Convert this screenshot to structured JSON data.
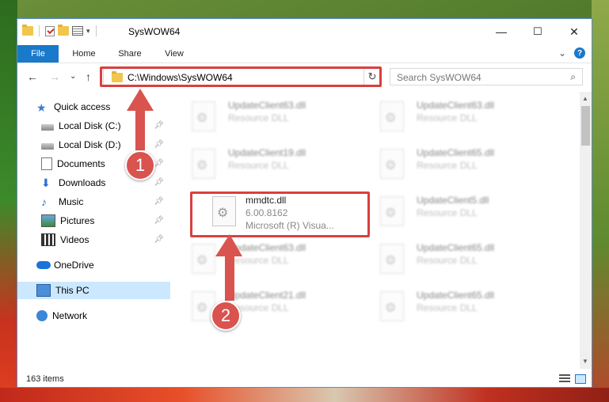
{
  "window": {
    "title": "SysWOW64",
    "controls": {
      "minimize": "—",
      "maximize": "☐",
      "close": "✕"
    }
  },
  "ribbon": {
    "tabs": [
      "File",
      "Home",
      "Share",
      "View"
    ],
    "collapse_glyph": "⌄",
    "help_glyph": "?"
  },
  "nav": {
    "back": "←",
    "forward": "→",
    "recent": "⌄",
    "up": "↑"
  },
  "address": {
    "path": "C:\\Windows\\SysWOW64",
    "dropdown_glyph": "⌄",
    "refresh_glyph": "↻"
  },
  "search": {
    "placeholder": "Search SysWOW64",
    "icon_glyph": "⌕"
  },
  "sidebar": {
    "items": [
      {
        "label": "Quick access",
        "icon": "star-icon"
      },
      {
        "label": "Local Disk (C:)",
        "icon": "drive-icon"
      },
      {
        "label": "Local Disk (D:)",
        "icon": "drive-icon"
      },
      {
        "label": "Documents",
        "icon": "documents-icon"
      },
      {
        "label": "Downloads",
        "icon": "downloads-icon"
      },
      {
        "label": "Music",
        "icon": "music-icon"
      },
      {
        "label": "Pictures",
        "icon": "pictures-icon"
      },
      {
        "label": "Videos",
        "icon": "videos-icon"
      },
      {
        "label": "OneDrive",
        "icon": "onedrive-icon"
      },
      {
        "label": "This PC",
        "icon": "this-pc-icon"
      },
      {
        "label": "Network",
        "icon": "network-icon"
      }
    ],
    "pin_glyph": "✎"
  },
  "files": [
    {
      "name": "UpdateClient63.dll",
      "desc": "Resource DLL"
    },
    {
      "name": "UpdateClient63.dll",
      "desc": "Resource DLL"
    },
    {
      "name": "UpdateClient19.dll",
      "desc": "Resource DLL"
    },
    {
      "name": "UpdateClient65.dll",
      "desc": "Resource DLL"
    },
    {
      "name": "mmdtc.dll",
      "desc": "6.00.8162",
      "desc2": "Microsoft (R) Visua..."
    },
    {
      "name": "UpdateClient5.dll",
      "desc": "Resource DLL"
    },
    {
      "name": "UpdateClient63.dll",
      "desc": "Resource DLL"
    },
    {
      "name": "UpdateClient65.dll",
      "desc": "Resource DLL"
    },
    {
      "name": "UpdateClient21.dll",
      "desc": "Resource DLL"
    },
    {
      "name": "UpdateClient65.dll",
      "desc": "Resource DLL"
    }
  ],
  "status": {
    "items_count": "163 items"
  },
  "annotations": {
    "step1": "1",
    "step2": "2"
  },
  "colors": {
    "accent": "#1979ca",
    "highlight": "#d94040",
    "selected": "#cce8ff"
  }
}
